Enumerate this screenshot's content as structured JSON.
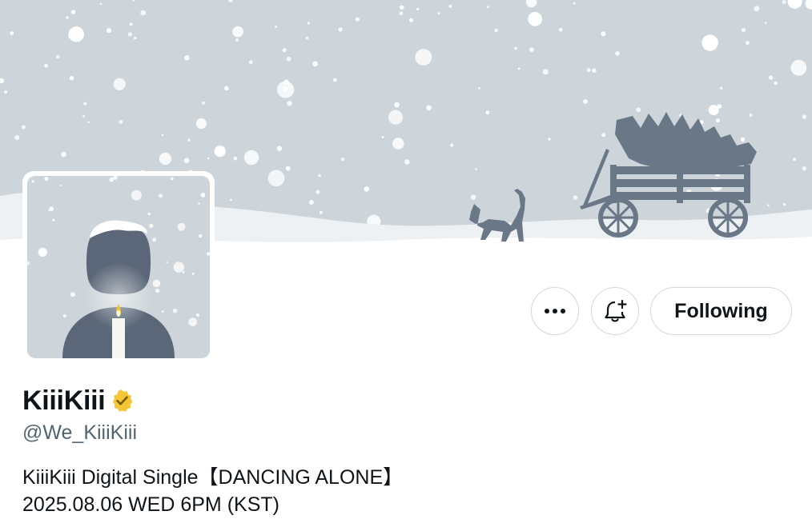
{
  "profile": {
    "display_name": "KiiiKiii",
    "handle": "@We_KiiiKiii",
    "verified": true,
    "verified_badge_color": "#F4C534",
    "bio_line1": "KiiiKiii Digital Single【DANCING ALONE】",
    "bio_line2": "2025.08.06 WED 6PM (KST)"
  },
  "actions": {
    "more_icon": "more-horizontal-icon",
    "notify_icon": "bell-plus-icon",
    "follow_label": "Following"
  },
  "banner": {
    "description_icons": [
      "cat-icon",
      "wagon-icon",
      "christmas-tree-icon",
      "snowflake-icon"
    ],
    "sky_color": "#CDD5DA",
    "snow_color": "#FFFFFF",
    "silhouette_color": "#6A7787"
  },
  "avatar": {
    "icons": [
      "candle-icon",
      "person-silhouette-icon"
    ],
    "background_color": "#CDD5DA"
  }
}
